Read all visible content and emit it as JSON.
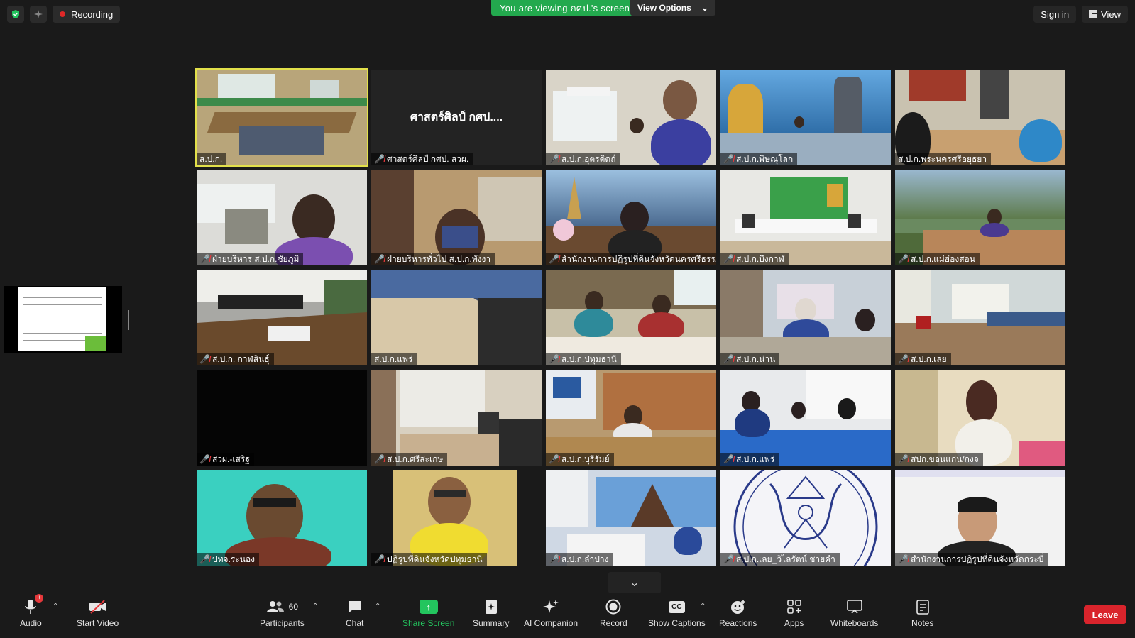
{
  "top": {
    "recording_label": "Recording",
    "viewing_banner": "You are viewing กศป.'s screen",
    "view_options_label": "View Options",
    "sign_in_label": "Sign in",
    "view_label": "View"
  },
  "tiles": [
    {
      "name": "ส.ป.ก.",
      "muted": false
    },
    {
      "name": "ศาสตร์ศิลป์ กศป. สวผ.",
      "center": "ศาสตร์ศิลป์ กศป....",
      "muted": true
    },
    {
      "name": "ส.ป.ก.อุตรดิตถ์",
      "muted": true
    },
    {
      "name": "ส.ป.ก.พิษณุโลก",
      "muted": true
    },
    {
      "name": "ส.ป.ก.พระนครศรีอยุธยา",
      "muted": false
    },
    {
      "name": "ฝ่ายบริหาร ส.ป.ก.ชัยภูมิ",
      "muted": true
    },
    {
      "name": "ฝ่ายบริหารทั่วไป ส.ป.ก.พังงา",
      "muted": true
    },
    {
      "name": "สำนักงานการปฏิรูปที่ดินจังหวัดนครศรีธรร...",
      "muted": true
    },
    {
      "name": "ส.ป.ก.บึงกาฬ",
      "muted": true
    },
    {
      "name": "ส.ป.ก.แม่ฮ่องสอน",
      "muted": true
    },
    {
      "name": "ส.ป.ก. กาฬสินธุ์",
      "muted": true
    },
    {
      "name": "ส.ป.ก.แพร่",
      "muted": false
    },
    {
      "name": "ส.ป.ก.ปทุมธานี",
      "muted": true
    },
    {
      "name": "ส.ป.ก.น่าน",
      "muted": true
    },
    {
      "name": "ส.ป.ก.เลย",
      "muted": true
    },
    {
      "name": "สวผ.-เสริฐ",
      "muted": true
    },
    {
      "name": "ส.ป.ก.ศรีสะเกษ",
      "muted": true
    },
    {
      "name": "ส.ป.ก.บุรีรัมย์",
      "muted": true
    },
    {
      "name": "ส.ป.ก.แพร่",
      "muted": true
    },
    {
      "name": "สปก.ขอนแก่น/กงจ",
      "muted": true
    },
    {
      "name": "ปทจ.ระนอง",
      "muted": true
    },
    {
      "name": "ปฏิรูปที่ดินจังหวัดปทุมธานี",
      "muted": true
    },
    {
      "name": "ส.ป.ก.ลำปาง",
      "muted": true
    },
    {
      "name": "ส.ป.ก.เลย_วิไลรัตน์ ชายคำ",
      "muted": true
    },
    {
      "name": "สำนักงานการปฏิรูปที่ดินจังหวัดกระบี่",
      "muted": true
    }
  ],
  "toolbar": {
    "audio_label": "Audio",
    "audio_badge": "!",
    "video_label": "Start Video",
    "participants_label": "Participants",
    "participants_count": "60",
    "chat_label": "Chat",
    "share_label": "Share Screen",
    "summary_label": "Summary",
    "ai_label": "AI Companion",
    "record_label": "Record",
    "captions_label": "Show Captions",
    "captions_icon_text": "CC",
    "reactions_label": "Reactions",
    "apps_label": "Apps",
    "whiteboards_label": "Whiteboards",
    "notes_label": "Notes",
    "leave_label": "Leave"
  },
  "colors": {
    "accent_green": "#23a94e",
    "leave_red": "#d9242c",
    "active_speaker": "#e2e04a"
  }
}
